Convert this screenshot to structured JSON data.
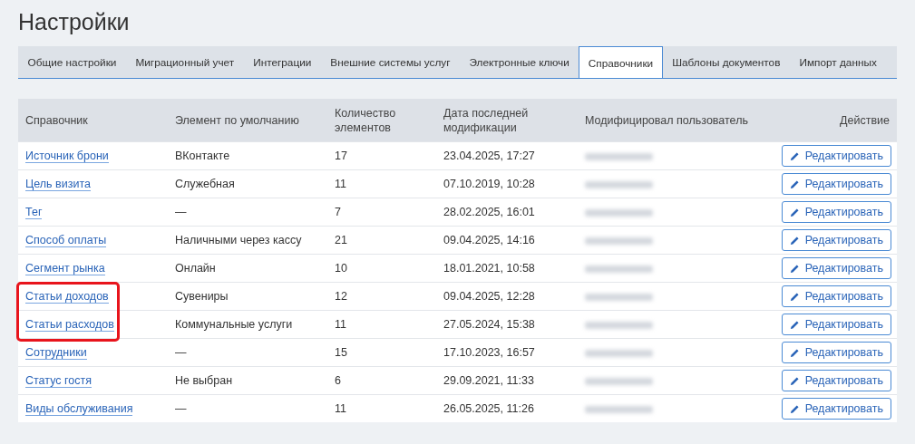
{
  "title": "Настройки",
  "tabs": [
    {
      "label": "Общие настройки",
      "selected": false
    },
    {
      "label": "Миграционный учет",
      "selected": false
    },
    {
      "label": "Интеграции",
      "selected": false
    },
    {
      "label": "Внешние системы услуг",
      "selected": false
    },
    {
      "label": "Электронные ключи",
      "selected": false
    },
    {
      "label": "Справочники",
      "selected": true
    },
    {
      "label": "Шаблоны документов",
      "selected": false
    },
    {
      "label": "Импорт данных",
      "selected": false
    }
  ],
  "table": {
    "columns": [
      "Справочник",
      "Элемент по умолчанию",
      "Количество элементов",
      "Дата последней модификации",
      "Модифицировал пользователь",
      "Действие"
    ],
    "rows": [
      {
        "name": "Источник брони",
        "default": "ВКонтакте",
        "count": "17",
        "modified": "23.04.2025, 17:27",
        "action": "Редактировать",
        "highlighted": false
      },
      {
        "name": "Цель визита",
        "default": "Служебная",
        "count": "11",
        "modified": "07.10.2019, 10:28",
        "action": "Редактировать",
        "highlighted": false
      },
      {
        "name": "Тег",
        "default": "—",
        "count": "7",
        "modified": "28.02.2025, 16:01",
        "action": "Редактировать",
        "highlighted": false
      },
      {
        "name": "Способ оплаты",
        "default": "Наличными через кассу",
        "count": "21",
        "modified": "09.04.2025, 14:16",
        "action": "Редактировать",
        "highlighted": false
      },
      {
        "name": "Сегмент рынка",
        "default": "Онлайн",
        "count": "10",
        "modified": "18.01.2021, 10:58",
        "action": "Редактировать",
        "highlighted": false
      },
      {
        "name": "Статьи доходов",
        "default": "Сувениры",
        "count": "12",
        "modified": "09.04.2025, 12:28",
        "action": "Редактировать",
        "highlighted": true
      },
      {
        "name": "Статьи расходов",
        "default": "Коммунальные услуги",
        "count": "11",
        "modified": "27.05.2024, 15:38",
        "action": "Редактировать",
        "highlighted": true
      },
      {
        "name": "Сотрудники",
        "default": "—",
        "count": "15",
        "modified": "17.10.2023, 16:57",
        "action": "Редактировать",
        "highlighted": false
      },
      {
        "name": "Статус гостя",
        "default": "Не выбран",
        "count": "6",
        "modified": "29.09.2021, 11:33",
        "action": "Редактировать",
        "highlighted": false
      },
      {
        "name": "Виды обслуживания",
        "default": "—",
        "count": "11",
        "modified": "26.05.2025, 11:26",
        "action": "Редактировать",
        "highlighted": false
      }
    ]
  }
}
